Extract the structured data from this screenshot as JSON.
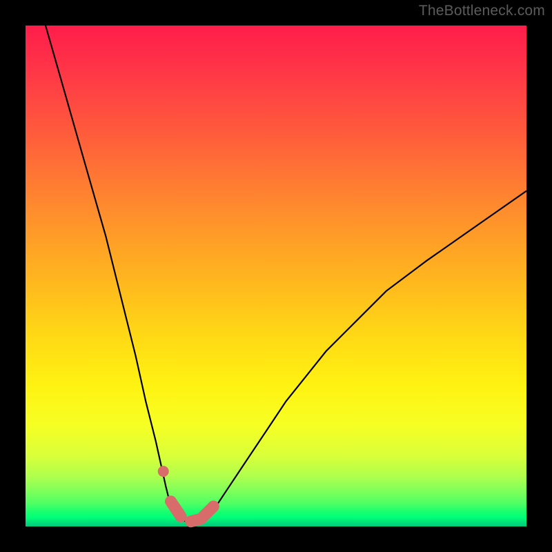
{
  "watermark": "TheBottleneck.com",
  "colors": {
    "frame": "#000000",
    "curve_stroke": "#000000",
    "marker_fill": "#d86c6a",
    "marker_stroke": "#d86c6a",
    "watermark": "#5c5c5c",
    "gradient_stops": [
      {
        "offset": 0.0,
        "color": "#ff1d4a"
      },
      {
        "offset": 0.5,
        "color": "#ffb41f"
      },
      {
        "offset": 0.8,
        "color": "#f6ff24"
      },
      {
        "offset": 1.0,
        "color": "#00c97c"
      }
    ]
  },
  "chart_data": {
    "type": "line",
    "title": "",
    "xlabel": "",
    "ylabel": "",
    "xlim": [
      0,
      100
    ],
    "ylim": [
      0,
      100
    ],
    "note": "Axes have no tick labels; values are read off the 726×726 plot area as 0–100 each. y shown here is 'height above bottom' so 0 = bottom (green), 100 = top (red). Curve is a V-shaped bottleneck dip; left branch starts at top-left and falls steeply to a flat trough near x≈29–36, right branch rises more gently toward upper-right.",
    "series": [
      {
        "name": "bottleneck-curve",
        "x": [
          4,
          6,
          8,
          10,
          12,
          14,
          16,
          18,
          20,
          22,
          24,
          26,
          28,
          29,
          30,
          32,
          34,
          36,
          38,
          40,
          44,
          48,
          52,
          56,
          60,
          66,
          72,
          80,
          90,
          100
        ],
        "y": [
          100,
          93,
          86,
          79,
          72,
          65,
          58,
          50,
          42,
          34,
          25,
          17,
          8,
          4,
          2,
          1,
          1,
          2,
          4,
          7,
          13,
          19,
          25,
          30,
          35,
          41,
          47,
          53,
          60,
          67
        ]
      }
    ],
    "markers": {
      "name": "trough-markers",
      "note": "Rounded salmon-colored capsule segment hugging the trough, plus one detached dot just up the left wall.",
      "points": [
        {
          "x": 27.5,
          "y": 11,
          "kind": "dot"
        },
        {
          "x": 29.0,
          "y": 5,
          "kind": "capsule-start"
        },
        {
          "x": 31.0,
          "y": 2,
          "kind": "capsule"
        },
        {
          "x": 33.0,
          "y": 1,
          "kind": "capsule"
        },
        {
          "x": 35.0,
          "y": 1.5,
          "kind": "capsule"
        },
        {
          "x": 37.5,
          "y": 4,
          "kind": "capsule"
        },
        {
          "x": 40.0,
          "y": 8,
          "kind": "capsule-end"
        }
      ]
    }
  }
}
